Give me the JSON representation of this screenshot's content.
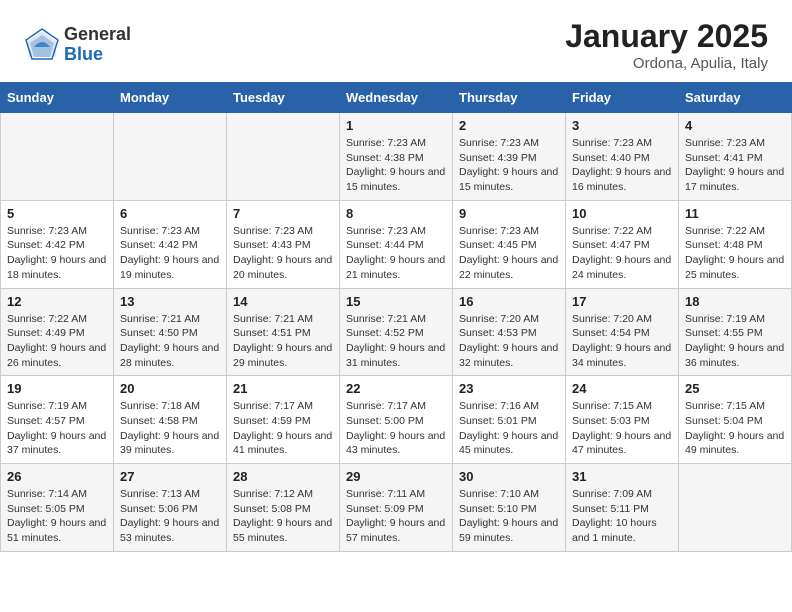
{
  "header": {
    "logo_general": "General",
    "logo_blue": "Blue",
    "main_title": "January 2025",
    "subtitle": "Ordona, Apulia, Italy"
  },
  "weekdays": [
    "Sunday",
    "Monday",
    "Tuesday",
    "Wednesday",
    "Thursday",
    "Friday",
    "Saturday"
  ],
  "weeks": [
    [
      {
        "day": "",
        "info": ""
      },
      {
        "day": "",
        "info": ""
      },
      {
        "day": "",
        "info": ""
      },
      {
        "day": "1",
        "info": "Sunrise: 7:23 AM\nSunset: 4:38 PM\nDaylight: 9 hours\nand 15 minutes."
      },
      {
        "day": "2",
        "info": "Sunrise: 7:23 AM\nSunset: 4:39 PM\nDaylight: 9 hours\nand 15 minutes."
      },
      {
        "day": "3",
        "info": "Sunrise: 7:23 AM\nSunset: 4:40 PM\nDaylight: 9 hours\nand 16 minutes."
      },
      {
        "day": "4",
        "info": "Sunrise: 7:23 AM\nSunset: 4:41 PM\nDaylight: 9 hours\nand 17 minutes."
      }
    ],
    [
      {
        "day": "5",
        "info": "Sunrise: 7:23 AM\nSunset: 4:42 PM\nDaylight: 9 hours\nand 18 minutes."
      },
      {
        "day": "6",
        "info": "Sunrise: 7:23 AM\nSunset: 4:42 PM\nDaylight: 9 hours\nand 19 minutes."
      },
      {
        "day": "7",
        "info": "Sunrise: 7:23 AM\nSunset: 4:43 PM\nDaylight: 9 hours\nand 20 minutes."
      },
      {
        "day": "8",
        "info": "Sunrise: 7:23 AM\nSunset: 4:44 PM\nDaylight: 9 hours\nand 21 minutes."
      },
      {
        "day": "9",
        "info": "Sunrise: 7:23 AM\nSunset: 4:45 PM\nDaylight: 9 hours\nand 22 minutes."
      },
      {
        "day": "10",
        "info": "Sunrise: 7:22 AM\nSunset: 4:47 PM\nDaylight: 9 hours\nand 24 minutes."
      },
      {
        "day": "11",
        "info": "Sunrise: 7:22 AM\nSunset: 4:48 PM\nDaylight: 9 hours\nand 25 minutes."
      }
    ],
    [
      {
        "day": "12",
        "info": "Sunrise: 7:22 AM\nSunset: 4:49 PM\nDaylight: 9 hours\nand 26 minutes."
      },
      {
        "day": "13",
        "info": "Sunrise: 7:21 AM\nSunset: 4:50 PM\nDaylight: 9 hours\nand 28 minutes."
      },
      {
        "day": "14",
        "info": "Sunrise: 7:21 AM\nSunset: 4:51 PM\nDaylight: 9 hours\nand 29 minutes."
      },
      {
        "day": "15",
        "info": "Sunrise: 7:21 AM\nSunset: 4:52 PM\nDaylight: 9 hours\nand 31 minutes."
      },
      {
        "day": "16",
        "info": "Sunrise: 7:20 AM\nSunset: 4:53 PM\nDaylight: 9 hours\nand 32 minutes."
      },
      {
        "day": "17",
        "info": "Sunrise: 7:20 AM\nSunset: 4:54 PM\nDaylight: 9 hours\nand 34 minutes."
      },
      {
        "day": "18",
        "info": "Sunrise: 7:19 AM\nSunset: 4:55 PM\nDaylight: 9 hours\nand 36 minutes."
      }
    ],
    [
      {
        "day": "19",
        "info": "Sunrise: 7:19 AM\nSunset: 4:57 PM\nDaylight: 9 hours\nand 37 minutes."
      },
      {
        "day": "20",
        "info": "Sunrise: 7:18 AM\nSunset: 4:58 PM\nDaylight: 9 hours\nand 39 minutes."
      },
      {
        "day": "21",
        "info": "Sunrise: 7:17 AM\nSunset: 4:59 PM\nDaylight: 9 hours\nand 41 minutes."
      },
      {
        "day": "22",
        "info": "Sunrise: 7:17 AM\nSunset: 5:00 PM\nDaylight: 9 hours\nand 43 minutes."
      },
      {
        "day": "23",
        "info": "Sunrise: 7:16 AM\nSunset: 5:01 PM\nDaylight: 9 hours\nand 45 minutes."
      },
      {
        "day": "24",
        "info": "Sunrise: 7:15 AM\nSunset: 5:03 PM\nDaylight: 9 hours\nand 47 minutes."
      },
      {
        "day": "25",
        "info": "Sunrise: 7:15 AM\nSunset: 5:04 PM\nDaylight: 9 hours\nand 49 minutes."
      }
    ],
    [
      {
        "day": "26",
        "info": "Sunrise: 7:14 AM\nSunset: 5:05 PM\nDaylight: 9 hours\nand 51 minutes."
      },
      {
        "day": "27",
        "info": "Sunrise: 7:13 AM\nSunset: 5:06 PM\nDaylight: 9 hours\nand 53 minutes."
      },
      {
        "day": "28",
        "info": "Sunrise: 7:12 AM\nSunset: 5:08 PM\nDaylight: 9 hours\nand 55 minutes."
      },
      {
        "day": "29",
        "info": "Sunrise: 7:11 AM\nSunset: 5:09 PM\nDaylight: 9 hours\nand 57 minutes."
      },
      {
        "day": "30",
        "info": "Sunrise: 7:10 AM\nSunset: 5:10 PM\nDaylight: 9 hours\nand 59 minutes."
      },
      {
        "day": "31",
        "info": "Sunrise: 7:09 AM\nSunset: 5:11 PM\nDaylight: 10 hours\nand 1 minute."
      },
      {
        "day": "",
        "info": ""
      }
    ]
  ]
}
